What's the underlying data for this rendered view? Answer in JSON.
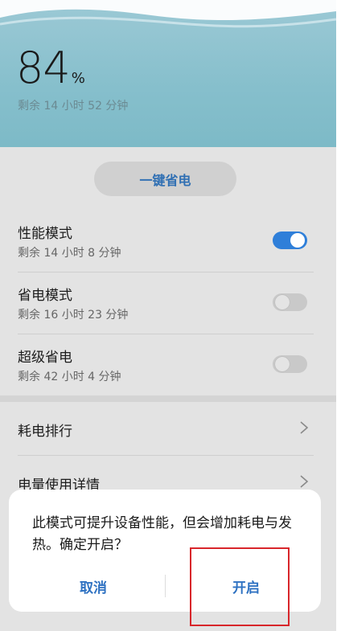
{
  "battery": {
    "percent": "84",
    "unit": "%",
    "remaining": "剩余 14 小时 52 分钟"
  },
  "one_key_save": "一键省电",
  "modes": [
    {
      "title": "性能模式",
      "subtitle": "剩余 14 小时 8 分钟",
      "enabled": true
    },
    {
      "title": "省电模式",
      "subtitle": "剩余 16 小时 23 分钟",
      "enabled": false
    },
    {
      "title": "超级省电",
      "subtitle": "剩余 42 小时 4 分钟",
      "enabled": false
    }
  ],
  "list": [
    {
      "label": "耗电排行"
    },
    {
      "label": "电量使用详情"
    }
  ],
  "dialog": {
    "message": "此模式可提升设备性能，但会增加耗电与发热。确定开启？",
    "cancel": "取消",
    "confirm": "开启"
  },
  "colors": {
    "accent": "#2f72c2",
    "toggle_on": "#2f7fd9",
    "header": "#86bfcc",
    "highlight": "#d8262b"
  }
}
